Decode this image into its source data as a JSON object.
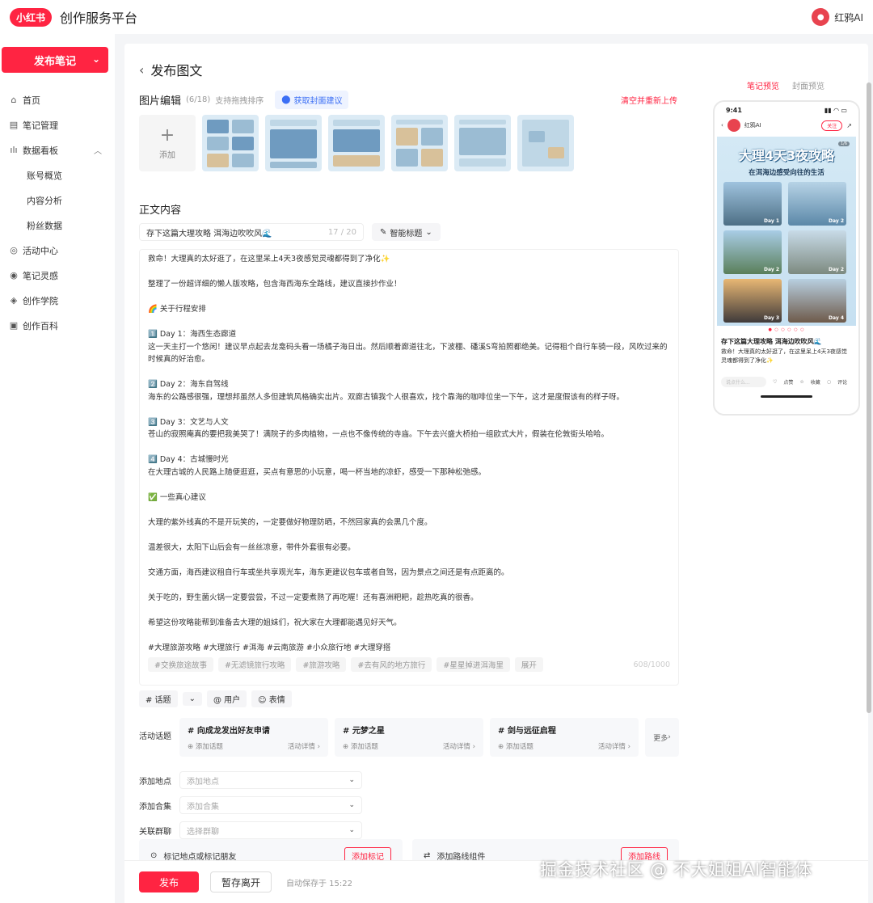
{
  "header": {
    "logo_text": "小红书",
    "title": "创作服务平台",
    "account_name": "红鸦AI"
  },
  "sidebar": {
    "publish_label": "发布笔记",
    "items": [
      {
        "label": "首页",
        "icon": "home-icon"
      },
      {
        "label": "笔记管理",
        "icon": "note-icon"
      },
      {
        "label": "数据看板",
        "icon": "chart-icon"
      },
      {
        "label": "账号概览"
      },
      {
        "label": "内容分析"
      },
      {
        "label": "粉丝数据"
      },
      {
        "label": "活动中心",
        "icon": "activity-icon"
      },
      {
        "label": "笔记灵感",
        "icon": "inspiration-icon"
      },
      {
        "label": "创作学院",
        "icon": "academy-icon"
      },
      {
        "label": "创作百科",
        "icon": "wiki-icon"
      }
    ]
  },
  "page": {
    "title": "发布图文"
  },
  "image_edit": {
    "title": "图片编辑",
    "count": "(6/18)",
    "hint": "支持拖拽排序",
    "cover_button": "获取封面建议",
    "clear_link": "清空并重新上传",
    "add_label": "添加"
  },
  "content": {
    "section_title": "正文内容",
    "title_value": "存下这篇大理攻略 洱海边吹吹风🌊",
    "title_count": "17 / 20",
    "smart_title": "智能标题",
    "paragraphs": [
      "救命！大理真的太好逛了，在这里呆上4天3夜感觉灵魂都得到了净化✨",
      "",
      "整理了一份超详细的懒人版攻略，包含海西海东全路线，建议直接抄作业！",
      "",
      "🌈 关于行程安排",
      "",
      "1️⃣ Day 1：海西生态廊道",
      "这一天主打一个悠闲！建议早点起去龙龛码头看一场橘子海日出。然后顺着廊道往北，下波棚、磻溪S弯拍照都绝美。记得租个自行车骑一段，风吹过来的时候真的好治愈。",
      "",
      "2️⃣ Day 2：海东自驾线",
      "海东的公路感很强，理想邦虽然人多但建筑风格确实出片。双廊古镇我个人很喜欢，找个靠海的咖啡位坐一下午，这才是度假该有的样子呀。",
      "",
      "3️⃣ Day 3：文艺与人文",
      "苍山的寂照庵真的要把我美哭了！满院子的多肉植物，一点也不像传统的寺庙。下午去兴盛大桥拍一组欧式大片，假装在伦敦街头哈哈。",
      "",
      "4️⃣ Day 4：古城慢时光",
      "在大理古城的人民路上随便逛逛，买点有意思的小玩意，喝一杯当地的凉虾，感受一下那种松弛感。",
      "",
      "✅ 一些真心建议",
      "",
      "大理的紫外线真的不是开玩笑的，一定要做好物理防晒，不然回家真的会黑几个度。",
      "",
      "温差很大，太阳下山后会有一丝丝凉意，带件外套很有必要。",
      "",
      "交通方面，海西建议租自行车或坐共享观光车，海东更建议包车或者自驾，因为景点之间还是有点距离的。",
      "",
      "关于吃的，野生菌火锅一定要尝尝，不过一定要煮熟了再吃喔！还有喜洲粑粑，趁热吃真的很香。",
      "",
      "希望这份攻略能帮到准备去大理的姐妹们，祝大家在大理都能遇见好天气。",
      "",
      "#大理旅游攻略 #大理旅行 #洱海 #云南旅游 #小众旅行地 #大理穿搭"
    ],
    "suggested_tags": [
      "#交换旅途故事",
      "#无滤镜旅行攻略",
      "#旅游攻略",
      "#去有风的地方旅行",
      "#星星掉进洱海里",
      "展开"
    ],
    "char_count": "608/1000"
  },
  "toolbar": {
    "topic": "# 话题",
    "user": "@ 用户",
    "emoji": "表情"
  },
  "activity": {
    "label": "活动话题",
    "cards": [
      {
        "name": "# 向成龙发出好友申请",
        "add": "添加话题",
        "detail": "活动详情"
      },
      {
        "name": "# 元梦之星",
        "add": "添加话题",
        "detail": "活动详情"
      },
      {
        "name": "# 剑与远征启程",
        "add": "添加话题",
        "detail": "活动详情"
      }
    ],
    "more": "更多"
  },
  "fields": [
    {
      "label": "添加地点",
      "placeholder": "添加地点"
    },
    {
      "label": "添加合集",
      "placeholder": "添加合集"
    },
    {
      "label": "关联群聊",
      "placeholder": "选择群聊"
    }
  ],
  "mark": {
    "text": "标记地点或标记朋友",
    "button": "添加标记"
  },
  "route": {
    "text": "添加路线组件",
    "button": "添加路线"
  },
  "bottom": {
    "publish": "发布",
    "draft": "暂存离开",
    "autosave": "自动保存于 15:22"
  },
  "preview": {
    "tab_note": "笔记预览",
    "tab_cover": "封面预览",
    "time": "9:41",
    "author": "红鸦AI",
    "follow": "关注",
    "page_badge": "1/6",
    "cover_title": "大理4天3夜攻略",
    "cover_subtitle": "在洱海边感受向往的生活",
    "day_labels": [
      "Day 1",
      "Day 2",
      "Day 2",
      "Day 2",
      "Day 3",
      "Day 4"
    ],
    "note_title": "存下这篇大理攻略 洱海边吹吹风🌊",
    "note_desc": "救命！大理真的太好逛了，在这里呆上4天3夜感觉灵魂都得到了净化✨",
    "say_placeholder": "说点什么...",
    "like": "点赞",
    "collect": "收藏",
    "comment": "评论"
  },
  "watermark": "掘金技术社区 @ 不大姐姐AI智能体"
}
